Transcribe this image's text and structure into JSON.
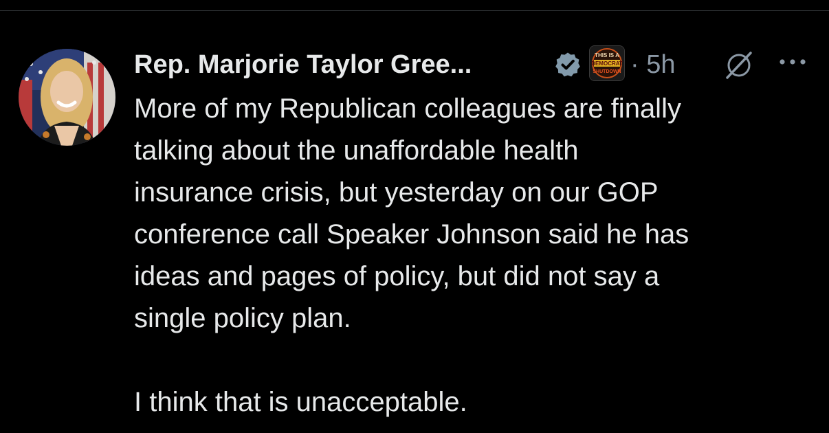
{
  "tweet": {
    "author_name": "Rep. Marjorie Taylor Gree...",
    "time": "· 5h",
    "badge_text": [
      "THIS IS A",
      "DEMOCRAT",
      "SHUTDOWN"
    ],
    "icons": {
      "verified": "verified-badge-icon",
      "affiliate": "affiliate-badge-icon",
      "grok": "grok-icon",
      "more": "more-options-icon"
    },
    "body_text": "More of my Republican colleagues are finally\ntalking about the unaffordable health\ninsurance crisis, but yesterday on our GOP\nconference call Speaker Johnson said he has\nideas and pages of policy, but did not say a\nsingle policy plan.\n\nI think that is unacceptable."
  },
  "colors": {
    "background": "#000000",
    "text": "#e7e9ea",
    "secondary_text": "#8b98a5",
    "verified": "#829aab"
  }
}
